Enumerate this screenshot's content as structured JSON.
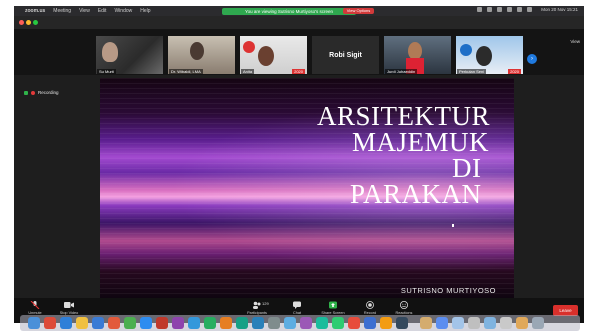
{
  "menubar": {
    "apple": "",
    "app_name": "zoom.us",
    "menus": [
      "Meeting",
      "View",
      "Edit",
      "Window",
      "Help"
    ],
    "share_banner": "You are viewing Sutrisno Murtiyoso's screen",
    "stop_button": "View Options",
    "clock": "Mon 20 Nov  15:21"
  },
  "participants": [
    {
      "name": "Su Murti"
    },
    {
      "name": "Dr. Wibaldi, LMA"
    },
    {
      "name": "Anita",
      "badge": "2020"
    },
    {
      "name": "Robi Sigit"
    },
    {
      "name": "Jurdi Juhaeddin"
    },
    {
      "name": "Perkutan Seni",
      "badge": "2020"
    }
  ],
  "view_label": "View",
  "recording_label": "Recording",
  "slide": {
    "lines": [
      "ARSITEKTUR",
      "MAJEMUK",
      "DI",
      "PARAKAN"
    ],
    "author": "SUTRISNO MURTIYOSO"
  },
  "toolbar": {
    "items": [
      "Unmute",
      "Stop Video",
      "Participants",
      "Chat",
      "Share Screen",
      "Record",
      "Reactions"
    ],
    "participants_count": "129",
    "leave": "Leave"
  },
  "colors": {
    "share_green": "#2fa84f",
    "leave_red": "#d9302c",
    "accent_blue": "#1f7ae0"
  }
}
